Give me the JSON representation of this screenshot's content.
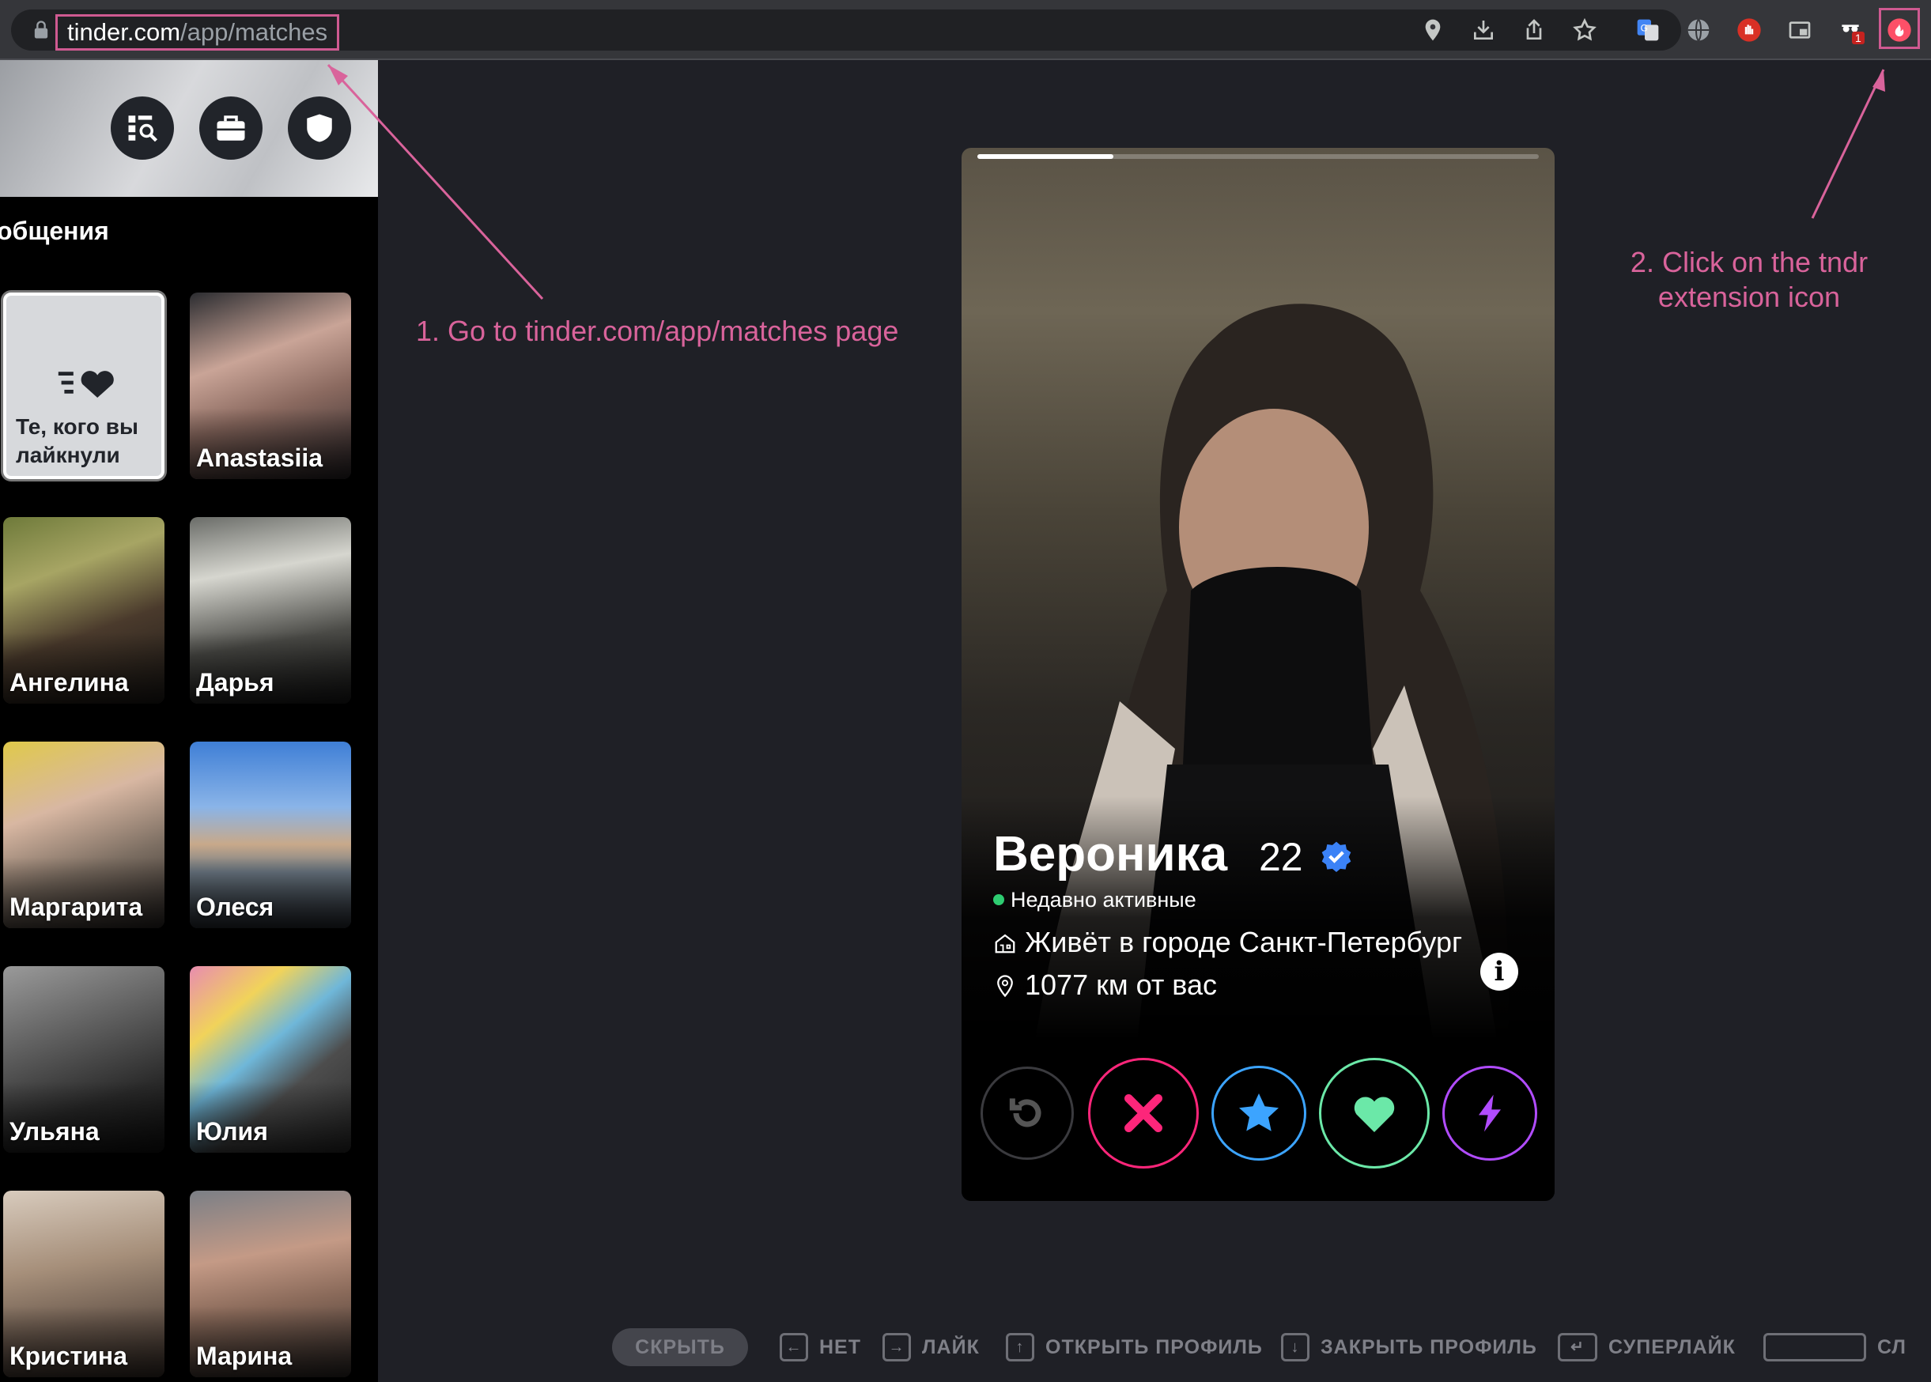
{
  "browser": {
    "url_host": "tinder.com",
    "url_path": "/app/matches",
    "ext_badge": "1"
  },
  "sidebar": {
    "title": "общения",
    "likes_tile_label": "Те, кого вы лайкнули",
    "matches": [
      {
        "name": "Anastasiia"
      },
      {
        "name": "Ангелина"
      },
      {
        "name": "Дарья"
      },
      {
        "name": "Маргарита"
      },
      {
        "name": "Олеся"
      },
      {
        "name": "Ульяна"
      },
      {
        "name": "Юлия"
      },
      {
        "name": "Кристина"
      },
      {
        "name": "Марина"
      }
    ]
  },
  "card": {
    "name": "Вероника",
    "age": "22",
    "status": "Недавно активные",
    "lives": "Живёт в городе Санкт-Петербург",
    "distance": "1077 км от вас",
    "info": "i"
  },
  "annotations": {
    "step1": "1. Go to tinder.com/app/matches page",
    "step2_line1": "2. Click on the tndr",
    "step2_line2": "extension icon"
  },
  "hotkeys": {
    "hide": "СКРЫТЬ",
    "items": [
      {
        "label": "НЕТ"
      },
      {
        "label": "ЛАЙК"
      },
      {
        "label": "ОТКРЫТЬ ПРОФИЛЬ"
      },
      {
        "label": "ЗАКРЫТЬ ПРОФИЛЬ"
      },
      {
        "label": "СУПЕРЛАЙК"
      },
      {
        "label": "СЛ"
      }
    ]
  },
  "colors": {
    "annotation": "#d9639b",
    "nope": "#fd267a",
    "superlike": "#3ca4ff",
    "like": "#6be8a8",
    "boost": "#b14cff",
    "rewind": "#555"
  }
}
